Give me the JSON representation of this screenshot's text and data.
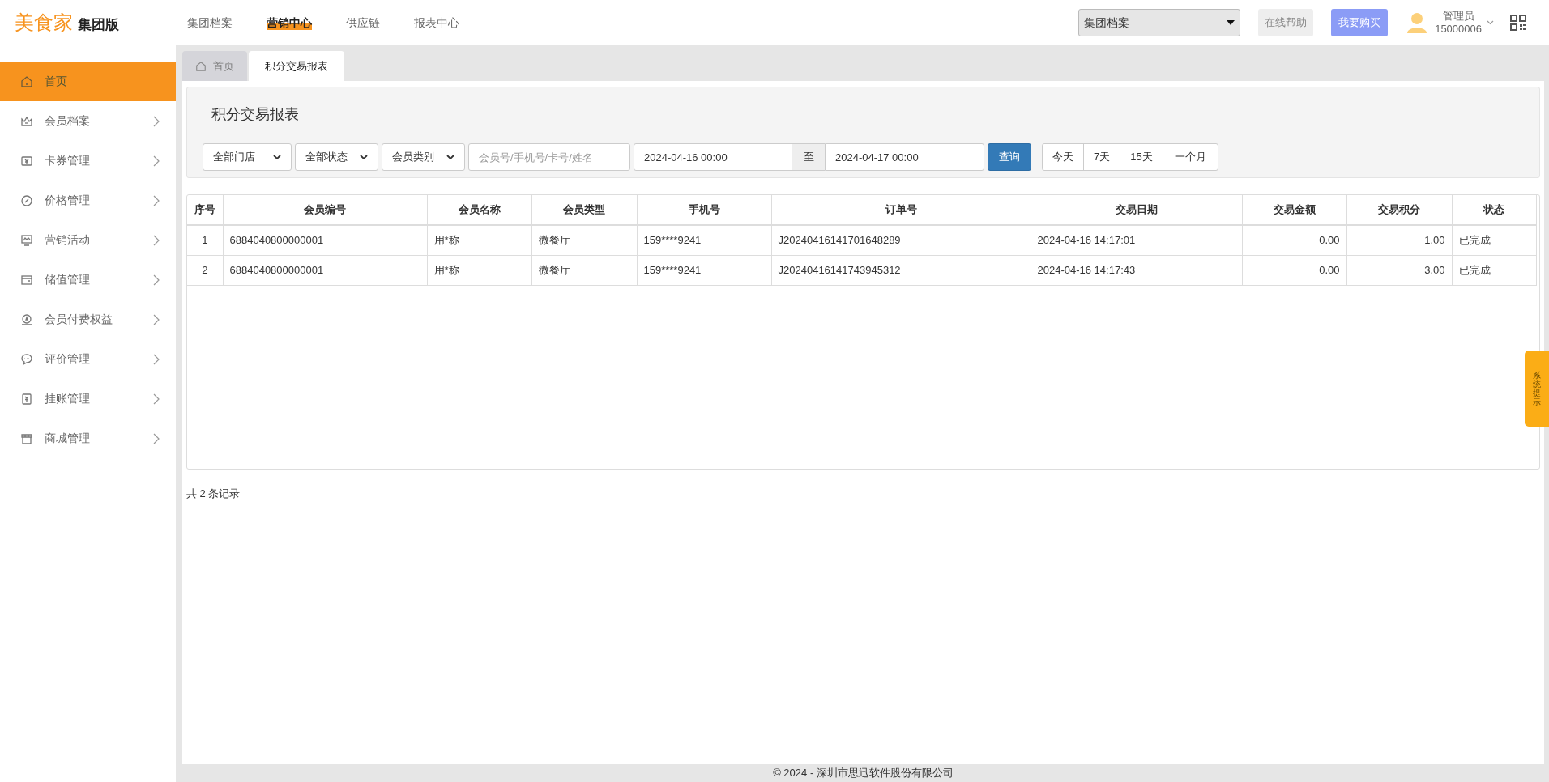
{
  "header": {
    "logo": "美食家",
    "edition": "集团版",
    "nav": [
      {
        "label": "集团档案",
        "selected": false
      },
      {
        "label": "营销中心",
        "selected": true
      },
      {
        "label": "供应链",
        "selected": false
      },
      {
        "label": "报表中心",
        "selected": false
      }
    ],
    "org_select": "集团档案",
    "help_button": "在线帮助",
    "buy_button": "我要购买",
    "user": {
      "role": "管理员",
      "account": "15000006"
    }
  },
  "sidebar": {
    "items": [
      {
        "label": "首页",
        "kind": "home",
        "selected": true,
        "expandable": false
      },
      {
        "label": "会员档案",
        "kind": "crown",
        "selected": false,
        "expandable": true
      },
      {
        "label": "卡券管理",
        "kind": "ticket",
        "selected": false,
        "expandable": true
      },
      {
        "label": "价格管理",
        "kind": "badge",
        "selected": false,
        "expandable": true
      },
      {
        "label": "营销活动",
        "kind": "monitor",
        "selected": false,
        "expandable": true
      },
      {
        "label": "储值管理",
        "kind": "wallet",
        "selected": false,
        "expandable": true
      },
      {
        "label": "会员付费权益",
        "kind": "medal",
        "selected": false,
        "expandable": true
      },
      {
        "label": "评价管理",
        "kind": "chat",
        "selected": false,
        "expandable": true
      },
      {
        "label": "挂账管理",
        "kind": "bill",
        "selected": false,
        "expandable": true
      },
      {
        "label": "商城管理",
        "kind": "store",
        "selected": false,
        "expandable": true
      }
    ]
  },
  "tabs": [
    {
      "label": "首页",
      "home": true,
      "selected": false
    },
    {
      "label": "积分交易报表",
      "home": false,
      "selected": true
    }
  ],
  "page_title": "积分交易报表",
  "filters": {
    "store": "全部门店",
    "status": "全部状态",
    "member_type": "会员类别",
    "search_placeholder": "会员号/手机号/卡号/姓名",
    "date_from": "2024-04-16 00:00",
    "range_sep": "至",
    "date_to": "2024-04-17 00:00",
    "query_button": "查询",
    "quick_ranges": [
      "今天",
      "7天",
      "15天",
      "一个月"
    ]
  },
  "table": {
    "columns": [
      "序号",
      "会员编号",
      "会员名称",
      "会员类型",
      "手机号",
      "订单号",
      "交易日期",
      "交易金额",
      "交易积分",
      "状态"
    ],
    "rows": [
      [
        "1",
        "6884040800000001",
        "用*称",
        "微餐厅",
        "159****9241",
        "J20240416141701648289",
        "2024-04-16 14:17:01",
        "0.00",
        "1.00",
        "已完成"
      ],
      [
        "2",
        "6884040800000001",
        "用*称",
        "微餐厅",
        "159****9241",
        "J20240416141743945312",
        "2024-04-16 14:17:43",
        "0.00",
        "3.00",
        "已完成"
      ]
    ]
  },
  "record_count": "共 2 条记录",
  "side_tab": "系统提示",
  "footer": "© 2024 - 深圳市思迅软件股份有限公司"
}
